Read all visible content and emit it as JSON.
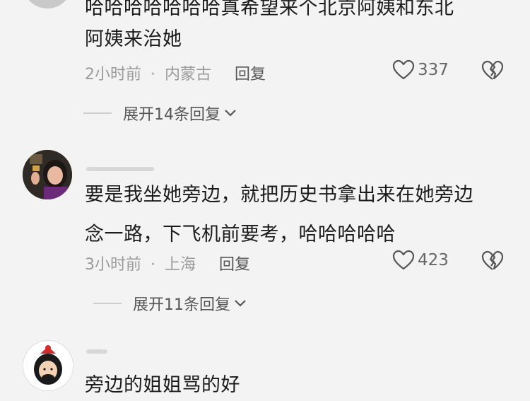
{
  "comments": [
    {
      "text_lines": [
        "哈哈哈哈哈哈哈真希望来个北京阿姨和东北",
        "阿姨来治她"
      ],
      "time": "2小时前",
      "location": "内蒙古",
      "reply_label": "回复",
      "likes": "337",
      "expand_label": "展开14条回复"
    },
    {
      "text_lines": [
        "要是我坐她旁边，就把历史书拿出来在她旁边",
        "念一路，下飞机前要考，哈哈哈哈哈"
      ],
      "time": "3小时前",
      "location": "上海",
      "reply_label": "回复",
      "likes": "423",
      "expand_label": "展开11条回复"
    },
    {
      "text_lines": [
        "旁边的姐姐骂的好"
      ]
    }
  ],
  "separator": "·",
  "icons": {
    "like": "heart-outline-icon",
    "dislike": "broken-heart-icon",
    "expand": "chevron-down-icon"
  },
  "colors": {
    "background": "#f3f3f3",
    "meta": "#9a9a9a",
    "text": "#1b1b1b"
  }
}
